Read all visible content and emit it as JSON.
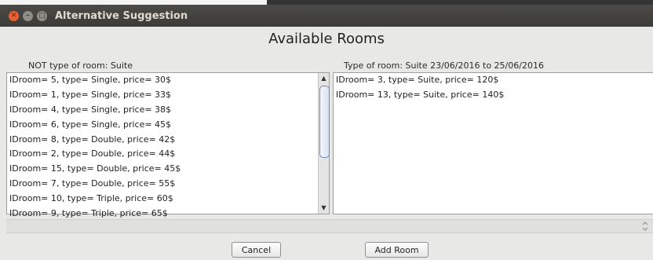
{
  "window": {
    "title": "Alternative Suggestion",
    "controls": {
      "close": "✕",
      "minimize": "–",
      "maximize": "□"
    }
  },
  "heading": "Available Rooms",
  "left_panel": {
    "label": "NOT type of room: Suite",
    "items": [
      "IDroom= 5, type= Single, price= 30$",
      "IDroom= 1, type= Single, price= 33$",
      "IDroom= 4, type= Single, price= 38$",
      "IDroom= 6, type= Single, price= 45$",
      "IDroom= 8, type= Double, price= 42$",
      "IDroom= 2, type= Double, price= 44$",
      "IDroom= 15, type= Double, price= 45$",
      "IDroom= 7, type= Double, price= 55$",
      "IDroom= 10, type= Triple, price= 60$",
      "IDroom= 9, type= Triple, price= 65$"
    ],
    "scroll_up": "▲",
    "scroll_down": "▼"
  },
  "right_panel": {
    "label": "Type of room: Suite 23/06/2016 to 25/06/2016",
    "items": [
      "IDroom= 3, type= Suite, price= 120$",
      "IDroom= 13, type= Suite, price= 140$"
    ]
  },
  "buttons": {
    "cancel": "Cancel",
    "add_room": "Add Room"
  }
}
